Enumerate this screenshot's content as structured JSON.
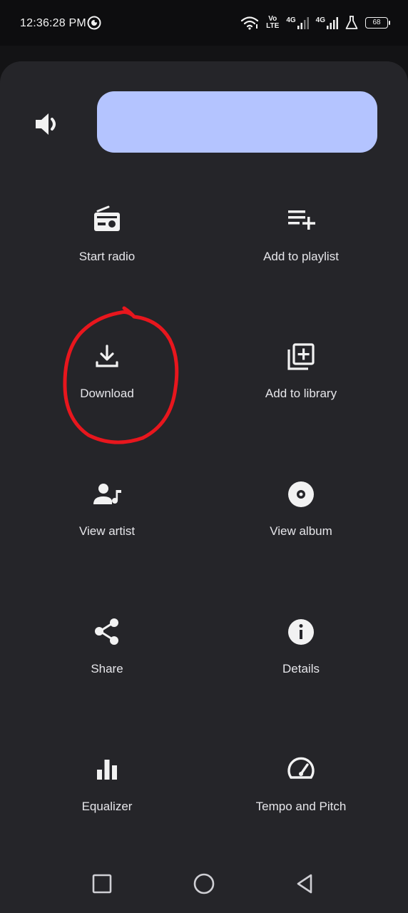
{
  "status_bar": {
    "time": "12:36:28 PM",
    "volte_top": "Vo",
    "volte_bottom": "LTE",
    "net1": "4G",
    "net2": "4G",
    "battery": "68"
  },
  "sheet": {
    "volume_level": 1.0,
    "items": [
      {
        "label": "Start radio",
        "icon": "radio-icon"
      },
      {
        "label": "Add to playlist",
        "icon": "playlist-add-icon"
      },
      {
        "label": "Download",
        "icon": "download-icon"
      },
      {
        "label": "Add to library",
        "icon": "library-add-icon"
      },
      {
        "label": "View artist",
        "icon": "artist-icon"
      },
      {
        "label": "View album",
        "icon": "album-icon"
      },
      {
        "label": "Share",
        "icon": "share-icon"
      },
      {
        "label": "Details",
        "icon": "info-icon"
      },
      {
        "label": "Equalizer",
        "icon": "equalizer-icon"
      },
      {
        "label": "Tempo and Pitch",
        "icon": "speed-icon"
      }
    ]
  },
  "colors": {
    "background": "#131315",
    "sheet": "#252529",
    "slider": "#b4c4ff",
    "annotation": "#e8161d"
  }
}
